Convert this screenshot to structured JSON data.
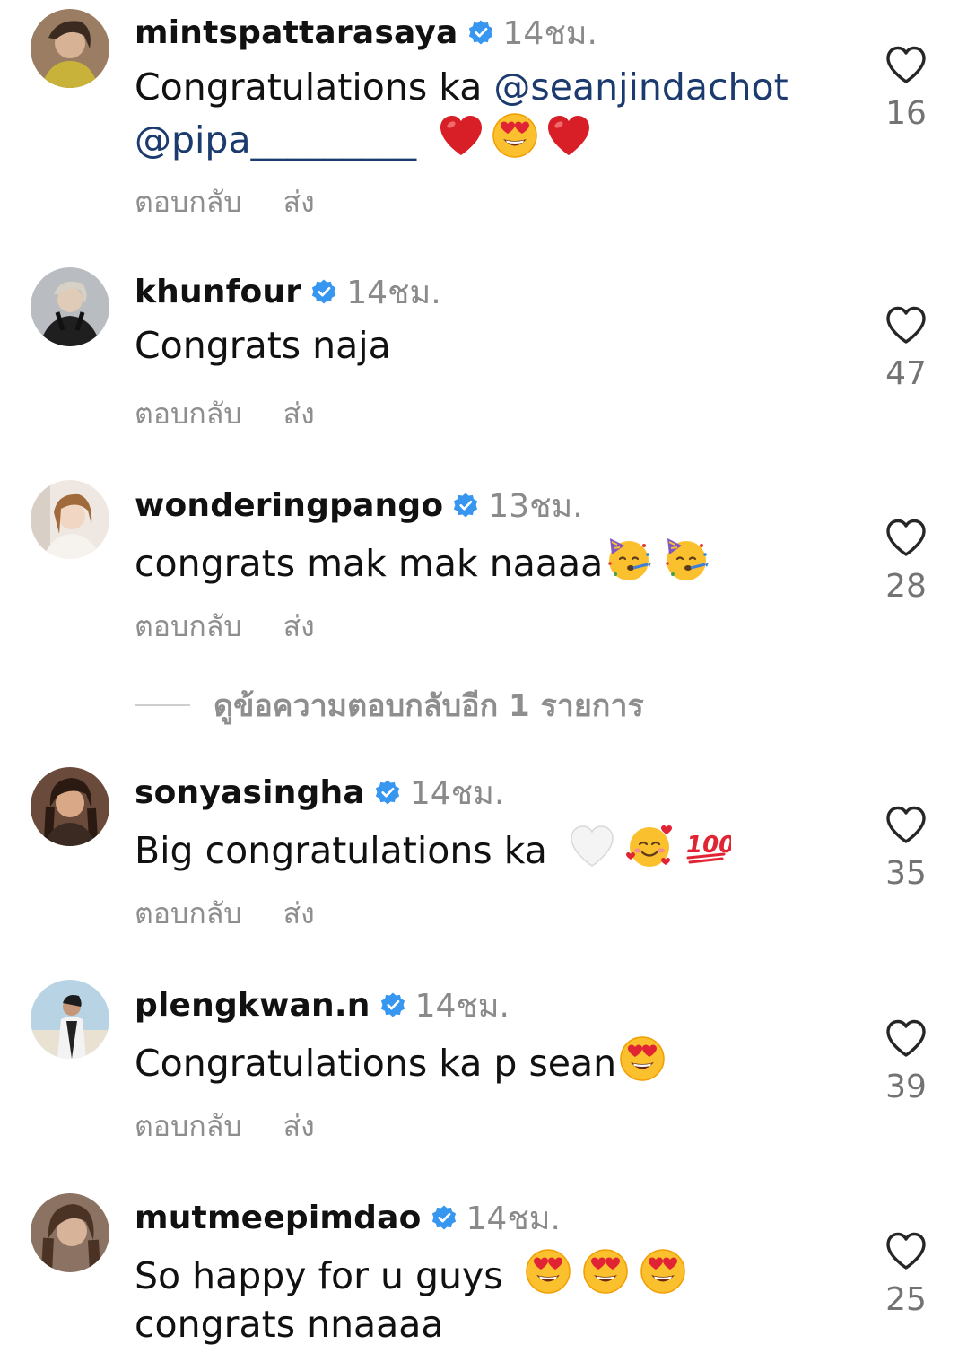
{
  "labels": {
    "reply": "ตอบกลับ",
    "send": "ส่ง",
    "view_more_replies": "ดูข้อความตอบกลับอีก 1 รายการ"
  },
  "colors": {
    "verified": "#3797f0",
    "mention": "#1b3b6f",
    "muted": "#8e8e8e"
  },
  "comments": [
    {
      "username": "mintspattarasaya",
      "time": "14ชม.",
      "text": "Congratulations ka ",
      "mention1": "@seanjindachot",
      "mention2": "@pipa_________",
      "emojis": [
        "red-heart",
        "heart-eyes",
        "red-heart"
      ],
      "likes": "16"
    },
    {
      "username": "khunfour",
      "time": "14ชม.",
      "text": "Congrats naja",
      "likes": "47"
    },
    {
      "username": "wonderingpango",
      "time": "13ชม.",
      "text": "congrats mak mak naaaa",
      "emojis": [
        "party-face",
        "party-face"
      ],
      "likes": "28"
    },
    {
      "username": "sonyasingha",
      "time": "14ชม.",
      "text": "Big congratulations ka ",
      "emojis": [
        "white-heart",
        "smiling-hearts",
        "hundred-points"
      ],
      "likes": "35"
    },
    {
      "username": "plengkwan.n",
      "time": "14ชม.",
      "text": "Congratulations ka p sean",
      "emojis": [
        "heart-eyes"
      ],
      "likes": "39"
    },
    {
      "username": "mutmeepimdao",
      "time": "14ชม.",
      "text": "So happy for u guys ",
      "text_line2": "congrats nnaaaa",
      "emojis": [
        "heart-eyes",
        "heart-eyes",
        "heart-eyes"
      ],
      "likes": "25"
    }
  ]
}
